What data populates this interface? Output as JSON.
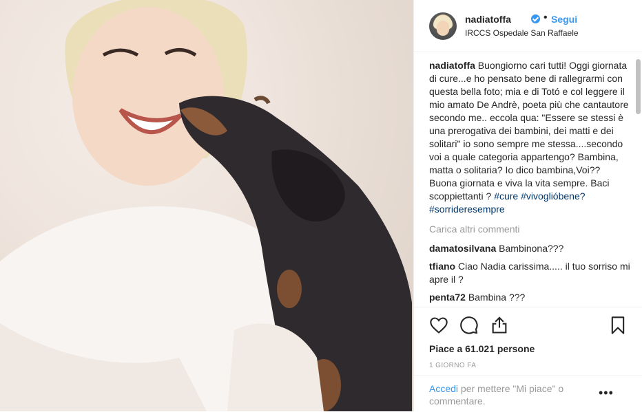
{
  "header": {
    "username": "nadiatoffa",
    "separator": "•",
    "follow_label": "Segui",
    "location": "IRCCS Ospedale San Raffaele"
  },
  "caption": {
    "username": "nadiatoffa",
    "text": "Buongiorno cari tutti! Oggi giornata di cure...e ho pensato bene di rallegrarmi con questa bella foto; mia e di Totó e col leggere il mio amato De Andrè, poeta più che cantautore secondo me.. eccola qua: \"Essere se stessi è una prerogativa dei bambini, dei matti e dei solitari\" io sono sempre me stessa....secondo voi a quale categoria appartengo? Bambina, matta o solitaria? Io dico bambina,Voi?? Buona giornata e viva la vita sempre. Baci scoppiettanti ?",
    "hashtag1": "#cure",
    "hashtag2": "#vivoglióbene?",
    "hashtag3": "#sorrideresempre"
  },
  "load_more": "Carica altri commenti",
  "comments": [
    {
      "user": "damatosilvana",
      "text": "Bambinona???"
    },
    {
      "user": "tfiano",
      "text": "Ciao Nadia carissima..... il tuo sorriso mi apre il ?"
    },
    {
      "user": "penta72",
      "text": "Bambina ???"
    }
  ],
  "likes": "Piace a 61.021 persone",
  "time": "1 GIORNO FA",
  "footer": {
    "login_link": "Accedi",
    "login_text": " per mettere \"Mi piace\" o commentare.",
    "options": "•••"
  },
  "icons": {
    "like": "heart-icon",
    "comment": "comment-icon",
    "share": "share-icon",
    "save": "bookmark-icon",
    "verified": "verified-badge-icon"
  },
  "colors": {
    "link_blue": "#3897f0",
    "hashtag": "#003569",
    "muted": "#999999",
    "border": "#efefef"
  }
}
